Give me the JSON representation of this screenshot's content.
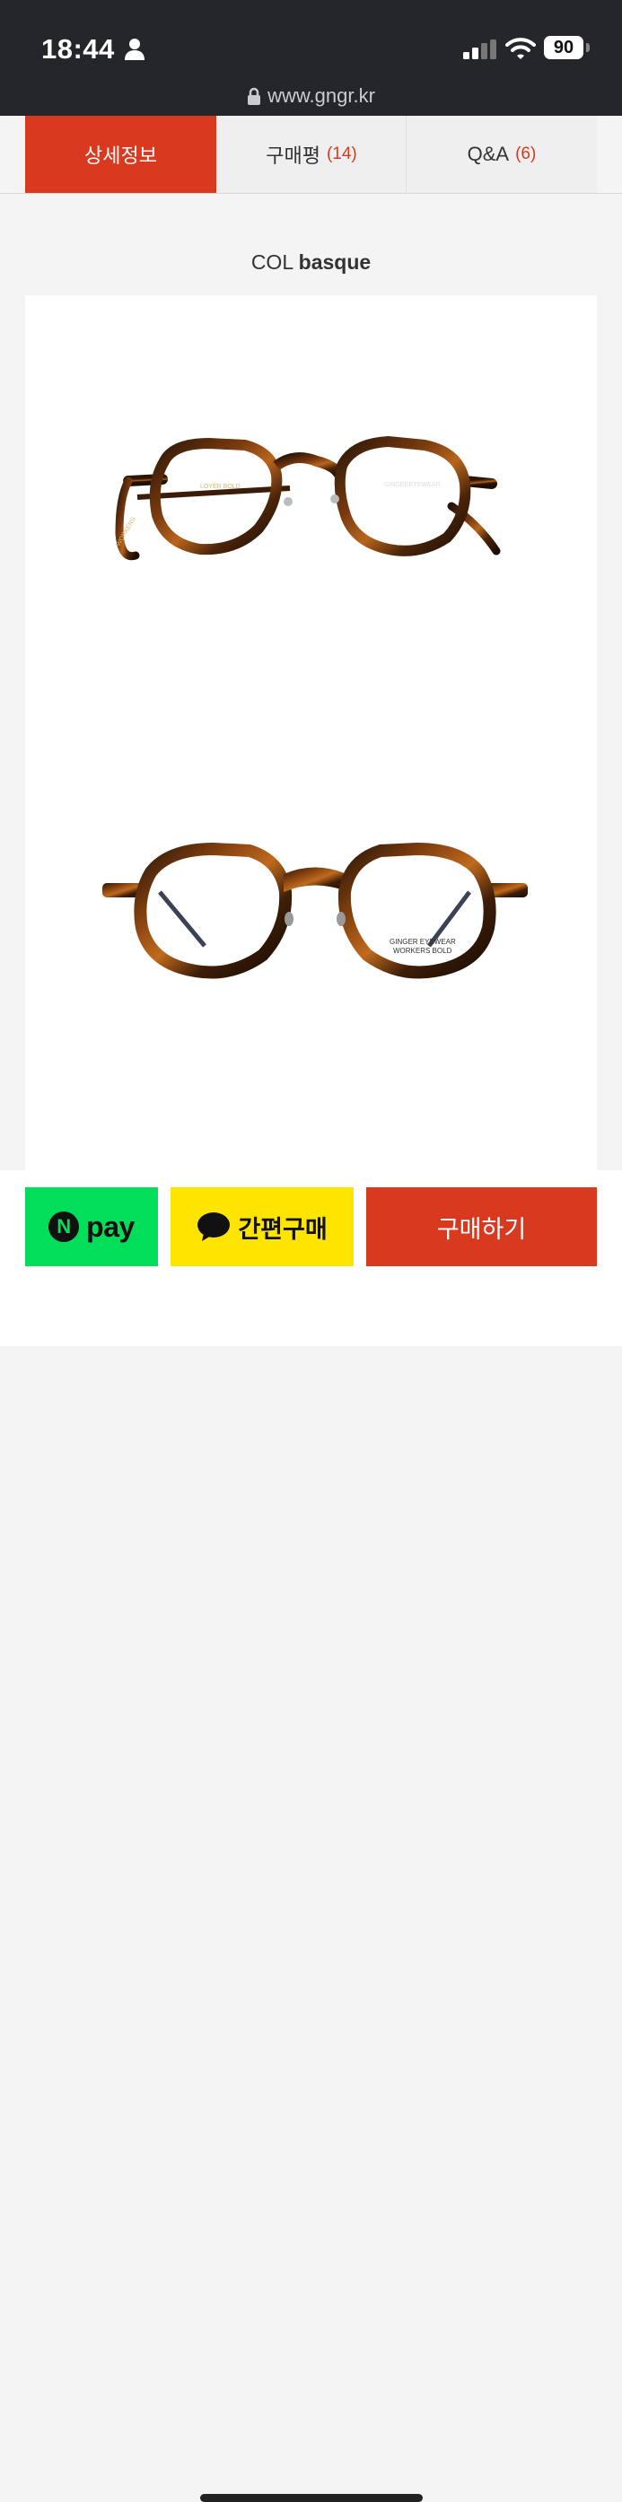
{
  "status_bar": {
    "time": "18:44",
    "battery": "90",
    "url": "www.gngr.kr"
  },
  "tabs": [
    {
      "label": "상세정보",
      "count": ""
    },
    {
      "label": "구매평",
      "count": "(14)"
    },
    {
      "label": "Q&A",
      "count": "(6)"
    }
  ],
  "product": {
    "prefix": "COL",
    "name": "basque"
  },
  "images": [
    {
      "temple_text": "LOYER BOLD",
      "brand_text": "GINGEREYEWEAR",
      "arm_text": "WORKERS"
    },
    {
      "lens_text_1": "GINGER EYEWEAR",
      "lens_text_2": "WORKERS BOLD"
    }
  ],
  "actions": {
    "npay_label": "pay",
    "npay_logo": "N",
    "kakao_label": "간편구매",
    "buy_label": "구매하기"
  },
  "colors": {
    "accent": "#d8391f",
    "npay": "#03de5a",
    "kakao": "#fee500",
    "status_bar": "#24262b"
  }
}
